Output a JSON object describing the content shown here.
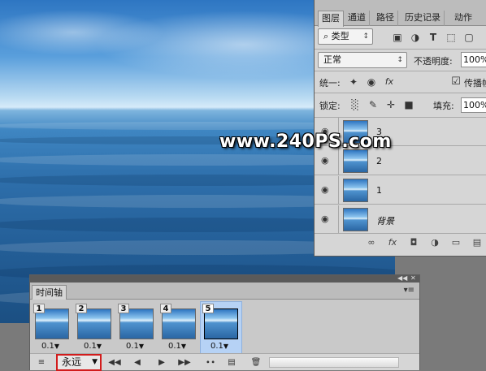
{
  "watermark": "www.240PS.com",
  "layers_panel": {
    "tabs": [
      "图层",
      "通道",
      "路径",
      "历史记录",
      "动作"
    ],
    "filter_kind": "类型",
    "blend_mode": "正常",
    "opacity_label": "不透明度:",
    "opacity_value": "100%",
    "unify_label": "统一:",
    "propagate_label": "传播帧",
    "lock_label": "锁定:",
    "fill_label": "填充:",
    "fill_value": "100%",
    "layers": [
      {
        "name": "3",
        "visible": true
      },
      {
        "name": "2",
        "visible": true
      },
      {
        "name": "1",
        "visible": true
      },
      {
        "name": "背景",
        "visible": true
      }
    ],
    "icons": {
      "filter": "search-icon",
      "image_filter": "image-icon",
      "adjust_filter": "circle-half-icon",
      "type_filter": "T",
      "shape_filter": "shape-icon",
      "smart_filter": "smart-object-icon"
    }
  },
  "timeline": {
    "title": "时间轴",
    "frames": [
      {
        "number": "1",
        "delay": "0.1"
      },
      {
        "number": "2",
        "delay": "0.1"
      },
      {
        "number": "3",
        "delay": "0.1"
      },
      {
        "number": "4",
        "delay": "0.1"
      },
      {
        "number": "5",
        "delay": "0.1",
        "selected": true
      }
    ],
    "loop_option": "永远"
  }
}
